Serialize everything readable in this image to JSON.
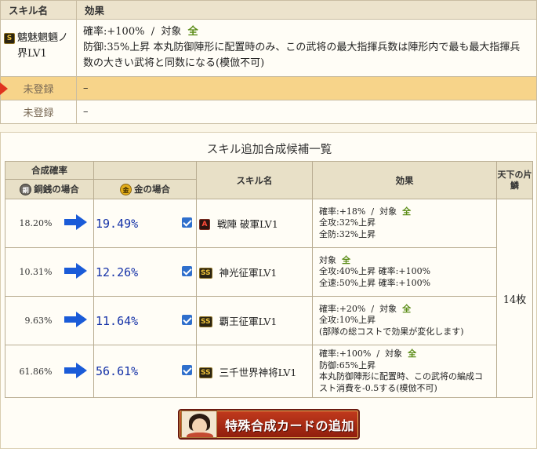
{
  "skill_table": {
    "header_name": "スキル名",
    "header_effect": "効果",
    "main_skill": {
      "rarity": "S",
      "name": "魑魅魍魎ノ界LV1",
      "effect_line1_pre": "確率:+100%  /  対象  ",
      "effect_line1_target": "全",
      "effect_line2": "防御:35%上昇  本丸防御陣形に配置時のみ、この武将の最大指揮兵数は陣形内で最も最大指揮兵数の大きい武将と同数になる(模倣不可)"
    },
    "slot2": {
      "name": "未登録",
      "effect": "–"
    },
    "slot3": {
      "name": "未登録",
      "effect": "–"
    }
  },
  "candidates": {
    "title": "スキル追加合成候補一覧",
    "headers": {
      "rate": "合成確率",
      "copper": "銅銭の場合",
      "gold": "金の場合",
      "skill": "スキル名",
      "effect": "効果",
      "tenka": "天下の片鱗",
      "copper_icon": "銅",
      "gold_icon": "金"
    },
    "tenka_value": "14枚",
    "rows": [
      {
        "copper_rate": "18.20%",
        "gold_rate": "19.49%",
        "rarity": "A",
        "skill": "戦陣 破軍LV1",
        "effect": [
          "確率:+18%  /  対象  ",
          "全攻:32%上昇",
          "全防:32%上昇"
        ],
        "target": "全"
      },
      {
        "copper_rate": "10.31%",
        "gold_rate": "12.26%",
        "rarity": "SS",
        "skill": "神光征軍LV1",
        "effect": [
          "対象  ",
          "全攻:40%上昇  確率:+100%",
          "全速:50%上昇  確率:+100%"
        ],
        "target": "全"
      },
      {
        "copper_rate": "9.63%",
        "gold_rate": "11.64%",
        "rarity": "SS",
        "skill": "覇王征軍LV1",
        "effect": [
          "確率:+20%  /  対象  ",
          "全攻:10%上昇",
          "(部隊の総コストで効果が変化します)"
        ],
        "target": "全"
      },
      {
        "copper_rate": "61.86%",
        "gold_rate": "56.61%",
        "rarity": "SS",
        "skill": "三千世界神将LV1",
        "effect": [
          "確率:+100%  /  対象  ",
          "防御:65%上昇",
          "本丸防御陣形に配置時、この武将の編成コスト消費を-0.5する(模倣不可)"
        ],
        "target": "全"
      }
    ]
  },
  "add_button": {
    "label": "特殊合成カードの追加"
  },
  "colors": {
    "accent_red": "#c23a1d",
    "rate_blue": "#1633a8",
    "target_green": "#5a8c16",
    "selected_row": "#f7d48a"
  }
}
